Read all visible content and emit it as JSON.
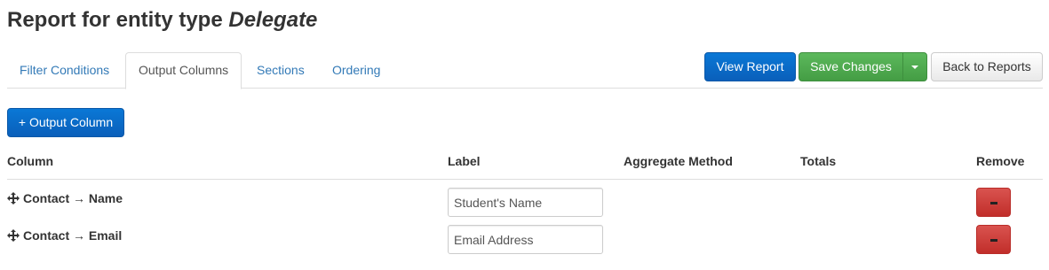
{
  "page": {
    "title_prefix": "Report for entity type ",
    "entity_type": "Delegate"
  },
  "tabs": [
    {
      "label": "Filter Conditions",
      "active": false
    },
    {
      "label": "Output Columns",
      "active": true
    },
    {
      "label": "Sections",
      "active": false
    },
    {
      "label": "Ordering",
      "active": false
    }
  ],
  "actions": {
    "view_report": "View Report",
    "save_changes": "Save Changes",
    "back_to_reports": "Back to Reports"
  },
  "add_output_column": "+ Output Column",
  "table": {
    "headers": {
      "column": "Column",
      "label": "Label",
      "aggregate": "Aggregate Method",
      "totals": "Totals",
      "remove": "Remove"
    },
    "rows": [
      {
        "column": "Contact → Name",
        "label_value": "Student's Name"
      },
      {
        "column": "Contact → Email",
        "label_value": "Email Address"
      }
    ]
  },
  "colors": {
    "primary": "#0a6ac8",
    "success": "#5cb85c",
    "danger": "#d9534f",
    "link": "#337ab7"
  },
  "icons": {
    "drag_handle": "move-icon",
    "remove": "minus-icon",
    "dropdown": "caret-down-icon"
  }
}
